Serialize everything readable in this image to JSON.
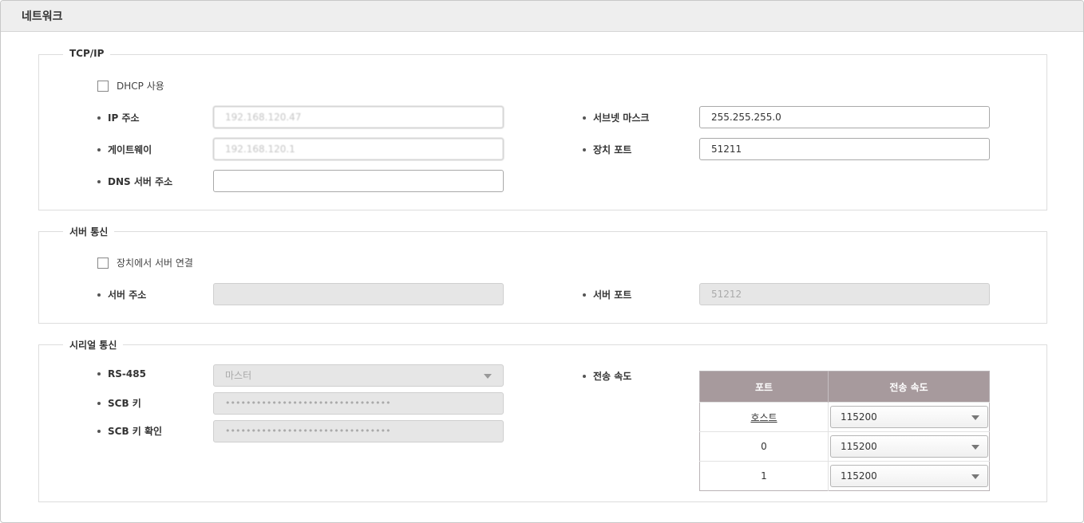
{
  "header": {
    "title": "네트워크"
  },
  "tcpip": {
    "legend": "TCP/IP",
    "dhcp_label": "DHCP 사용",
    "ip_label": "IP 주소",
    "ip_value": "192.168.120.47",
    "subnet_label": "서브넷 마스크",
    "subnet_value": "255.255.255.0",
    "gateway_label": "게이트웨이",
    "gateway_value": "192.168.120.1",
    "device_port_label": "장치 포트",
    "device_port_value": "51211",
    "dns_label": "DNS 서버 주소",
    "dns_value": ""
  },
  "server": {
    "legend": "서버 통신",
    "connect_label": "장치에서 서버 연결",
    "address_label": "서버 주소",
    "address_value": "",
    "port_label": "서버 포트",
    "port_value": "51212"
  },
  "serial": {
    "legend": "시리얼 통신",
    "rs485_label": "RS-485",
    "rs485_value": "마스터",
    "scb_key_label": "SCB 키",
    "scb_key_value": "••••••••••••••••••••••••••••••••",
    "scb_confirm_label": "SCB 키 확인",
    "scb_confirm_value": "••••••••••••••••••••••••••••••••",
    "baud_label": "전송 속도",
    "table": {
      "headers": [
        "포트",
        "전송 속도"
      ],
      "rows": [
        {
          "port": "호스트",
          "baud": "115200"
        },
        {
          "port": "0",
          "baud": "115200"
        },
        {
          "port": "1",
          "baud": "115200"
        }
      ]
    }
  }
}
